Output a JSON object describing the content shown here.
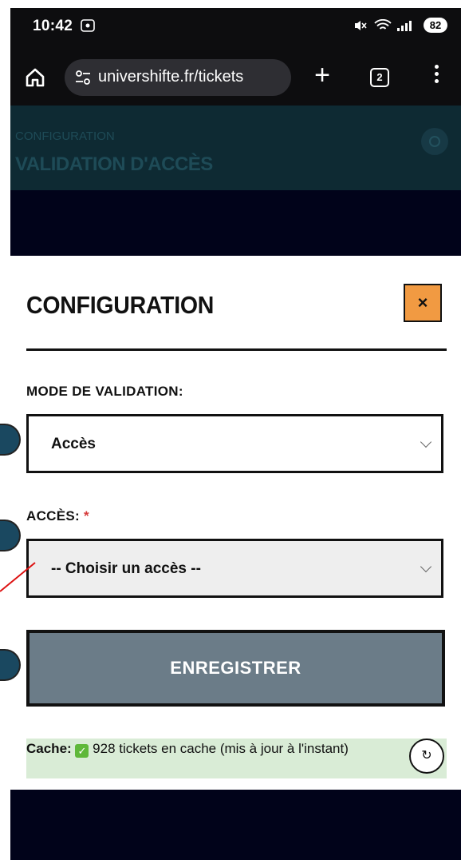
{
  "status_bar": {
    "time": "10:42",
    "battery": "82"
  },
  "browser": {
    "url": "univershifte.fr/tickets",
    "tab_count": "2"
  },
  "page_header": {
    "subtitle": "CONFIGURATION",
    "title": "VALIDATION D'ACCÈS"
  },
  "modal": {
    "title": "CONFIGURATION",
    "close_label": "×",
    "mode_label": "MODE DE VALIDATION:",
    "mode_value": "Accès",
    "access_label": "ACCÈS:",
    "access_required": "*",
    "access_value": "-- Choisir un accès --",
    "save_label": "ENREGISTRER",
    "cache_label": "Cache:",
    "cache_text": "928 tickets en cache (mis à jour à l'instant)",
    "refresh_icon": "↻"
  },
  "colors": {
    "accent_orange": "#f19a42",
    "save_button": "#6b7c88",
    "cache_bg": "#d9ecd6",
    "header_bg": "#0e2a33"
  }
}
